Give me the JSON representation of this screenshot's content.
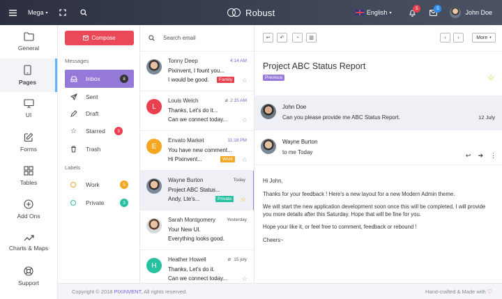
{
  "navbar": {
    "mega_label": "Mega",
    "brand": "Robust",
    "language": "English",
    "notifications_count": "5",
    "messages_count": "5",
    "user_name": "John Doe",
    "colors": {
      "notif": "#e8404f",
      "messages": "#2f8ef2"
    }
  },
  "mainmenu": {
    "items": [
      {
        "label": "General",
        "icon": "folder-icon"
      },
      {
        "label": "Pages",
        "icon": "tablet-icon"
      },
      {
        "label": "UI",
        "icon": "monitor-icon"
      },
      {
        "label": "Forms",
        "icon": "edit-icon"
      },
      {
        "label": "Tables",
        "icon": "grid-icon"
      },
      {
        "label": "Add Ons",
        "icon": "plus-circle-icon"
      },
      {
        "label": "Charts & Maps",
        "icon": "trend-icon"
      },
      {
        "label": "Support",
        "icon": "lifebuoy-icon"
      }
    ],
    "active": "Pages"
  },
  "sidebar": {
    "compose_label": "Compose",
    "messages_heading": "Messages",
    "labels_heading": "Labels",
    "folders": [
      {
        "label": "Inbox",
        "count": "8",
        "icon": "inbox-icon"
      },
      {
        "label": "Sent",
        "icon": "send-icon"
      },
      {
        "label": "Draft",
        "icon": "draft-icon"
      },
      {
        "label": "Starred",
        "count": "3",
        "icon": "star-icon"
      },
      {
        "label": "Trash",
        "icon": "trash-icon"
      }
    ],
    "labels": [
      {
        "label": "Work",
        "count": "5",
        "color": "#f5a623"
      },
      {
        "label": "Private",
        "count": "3",
        "color": "#28c0a0"
      }
    ]
  },
  "email_list": {
    "search_placeholder": "Search email",
    "mails": [
      {
        "initial": "",
        "from": "Tonny Deep",
        "time": "4:14 AM",
        "subject": "Pixinvent, I fount you...",
        "preview": "I would be good.",
        "tag": "Family",
        "tag_color": "#e8404f",
        "avatar": "photo"
      },
      {
        "initial": "L",
        "from": "Louis Welch",
        "time": "2:15 AM",
        "subject": "Thanks, Let's do it...",
        "preview": "Can we connect today...",
        "tag": "",
        "avatar_color": "#e8404f",
        "attachment": true
      },
      {
        "initial": "E",
        "from": "Envato Market",
        "time": "11:18 PM",
        "subject": "You have new comment...",
        "preview": "Hi Pixinvent...",
        "tag": "Work",
        "tag_color": "#f5a623",
        "avatar_color": "#f5a623"
      },
      {
        "initial": "",
        "from": "Wayne Burton",
        "time": "Today",
        "subject": "Project ABC Status...",
        "preview": "Andy, Lte's...",
        "tag": "Private",
        "tag_color": "#28c0a0",
        "avatar": "photo"
      },
      {
        "initial": "",
        "from": "Sarah Montgomery",
        "time": "Yesterday",
        "subject": "Your New UI.",
        "preview": "Everything looks good.",
        "tag": "",
        "avatar": "photo"
      },
      {
        "initial": "H",
        "from": "Heather Howell",
        "time": "15 july",
        "subject": "Thanks, Let's do it.",
        "preview": "Can we connect today...",
        "tag": "",
        "avatar_color": "#28c0a0",
        "attachment": true
      }
    ]
  },
  "detail": {
    "more_label": "More",
    "title": "Project ABC Status Report",
    "badge": "Previous",
    "thread": [
      {
        "name": "John Doe",
        "subtitle": "Can you please provide me ABC Status Report.",
        "date": "12 July"
      },
      {
        "name": "Wayne Burton",
        "subtitle": "to me Today"
      }
    ],
    "body": [
      "Hi John,",
      "Thanks for your feedback ! Here's a new layout for a new Modern Admin theme.",
      "We will start the new application development soon once this will be completed, I will provide you more details after this Saturday. Hope that will be fine for you.",
      "Hope your like it, or feel free to comment, feedback or rebound !",
      "Cheers~"
    ]
  },
  "footer": {
    "copyright_prefix": "Copyright © 2018",
    "brand": "PIXINVENT",
    "copyright_suffix": ", All rights reserved.",
    "right": "Hand-crafted & Made with"
  }
}
